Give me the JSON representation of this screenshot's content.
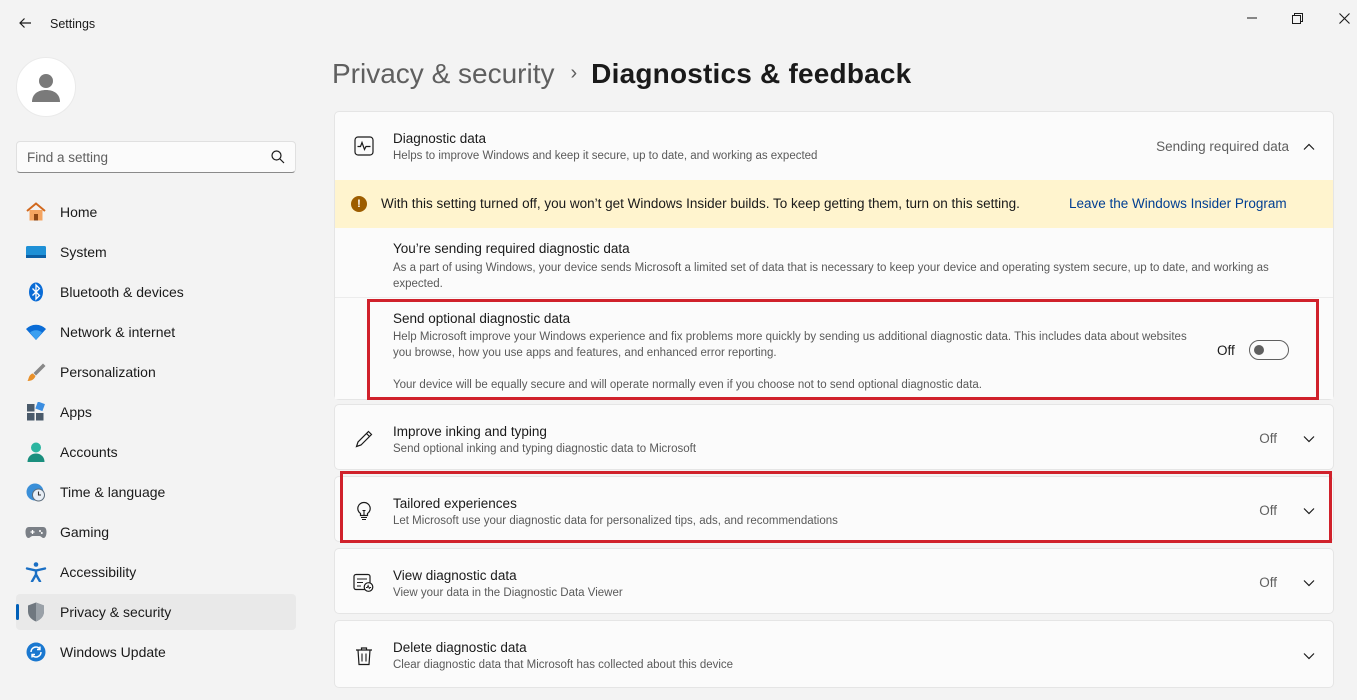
{
  "window": {
    "title": "Settings",
    "back_icon": "back-arrow-icon",
    "controls": [
      "minimize-icon",
      "maximize-icon",
      "close-icon"
    ]
  },
  "search": {
    "placeholder": "Find a setting",
    "icon": "search-icon"
  },
  "sidebar": {
    "items": [
      {
        "label": "Home",
        "icon": "home-icon",
        "active": false
      },
      {
        "label": "System",
        "icon": "system-icon",
        "active": false
      },
      {
        "label": "Bluetooth & devices",
        "icon": "bluetooth-icon",
        "active": false
      },
      {
        "label": "Network & internet",
        "icon": "wifi-icon",
        "active": false
      },
      {
        "label": "Personalization",
        "icon": "brush-icon",
        "active": false
      },
      {
        "label": "Apps",
        "icon": "apps-icon",
        "active": false
      },
      {
        "label": "Accounts",
        "icon": "accounts-icon",
        "active": false
      },
      {
        "label": "Time & language",
        "icon": "time-language-icon",
        "active": false
      },
      {
        "label": "Gaming",
        "icon": "gamepad-icon",
        "active": false
      },
      {
        "label": "Accessibility",
        "icon": "accessibility-icon",
        "active": false
      },
      {
        "label": "Privacy & security",
        "icon": "shield-icon",
        "active": true
      },
      {
        "label": "Windows Update",
        "icon": "update-icon",
        "active": false
      }
    ]
  },
  "header": {
    "parent": "Privacy & security",
    "separator": "›",
    "current": "Diagnostics & feedback"
  },
  "diagnostic_data": {
    "title": "Diagnostic data",
    "description": "Helps to improve Windows and keep it secure, up to date, and working as expected",
    "status": "Sending required data",
    "icon": "diagnostic-pulse-icon",
    "warning": {
      "text": "With this setting turned off, you won’t get Windows Insider builds. To keep getting them, turn on this setting.",
      "link": "Leave the Windows Insider Program"
    },
    "required": {
      "title": "You’re sending required diagnostic data",
      "description": "As a part of using Windows, your device sends Microsoft a limited set of data that is necessary to keep your device and operating system secure, up to date, and working as expected."
    },
    "optional": {
      "title": "Send optional diagnostic data",
      "description": "Help Microsoft improve your Windows experience and fix problems more quickly by sending us additional diagnostic data. This includes data about websites you browse, how you use apps and features, and enhanced error reporting.",
      "note": "Your device will be equally secure and will operate normally even if you choose not to send optional diagnostic data.",
      "toggle_label": "Off",
      "toggle_on": false
    }
  },
  "cards": [
    {
      "title": "Improve inking and typing",
      "description": "Send optional inking and typing diagnostic data to Microsoft",
      "status": "Off",
      "icon": "pen-icon"
    },
    {
      "title": "Tailored experiences",
      "description": "Let Microsoft use your diagnostic data for personalized tips, ads, and recommendations",
      "status": "Off",
      "icon": "lightbulb-icon"
    },
    {
      "title": "View diagnostic data",
      "description": "View your data in the Diagnostic Data Viewer",
      "status": "Off",
      "icon": "data-viewer-icon"
    },
    {
      "title": "Delete diagnostic data",
      "description": "Clear diagnostic data that Microsoft has collected about this device",
      "status": "",
      "icon": "trash-icon"
    }
  ],
  "colors": {
    "accent": "#005fb8",
    "highlight": "#d0212b",
    "warning_bg": "#fff4ce",
    "link": "#003e92"
  }
}
